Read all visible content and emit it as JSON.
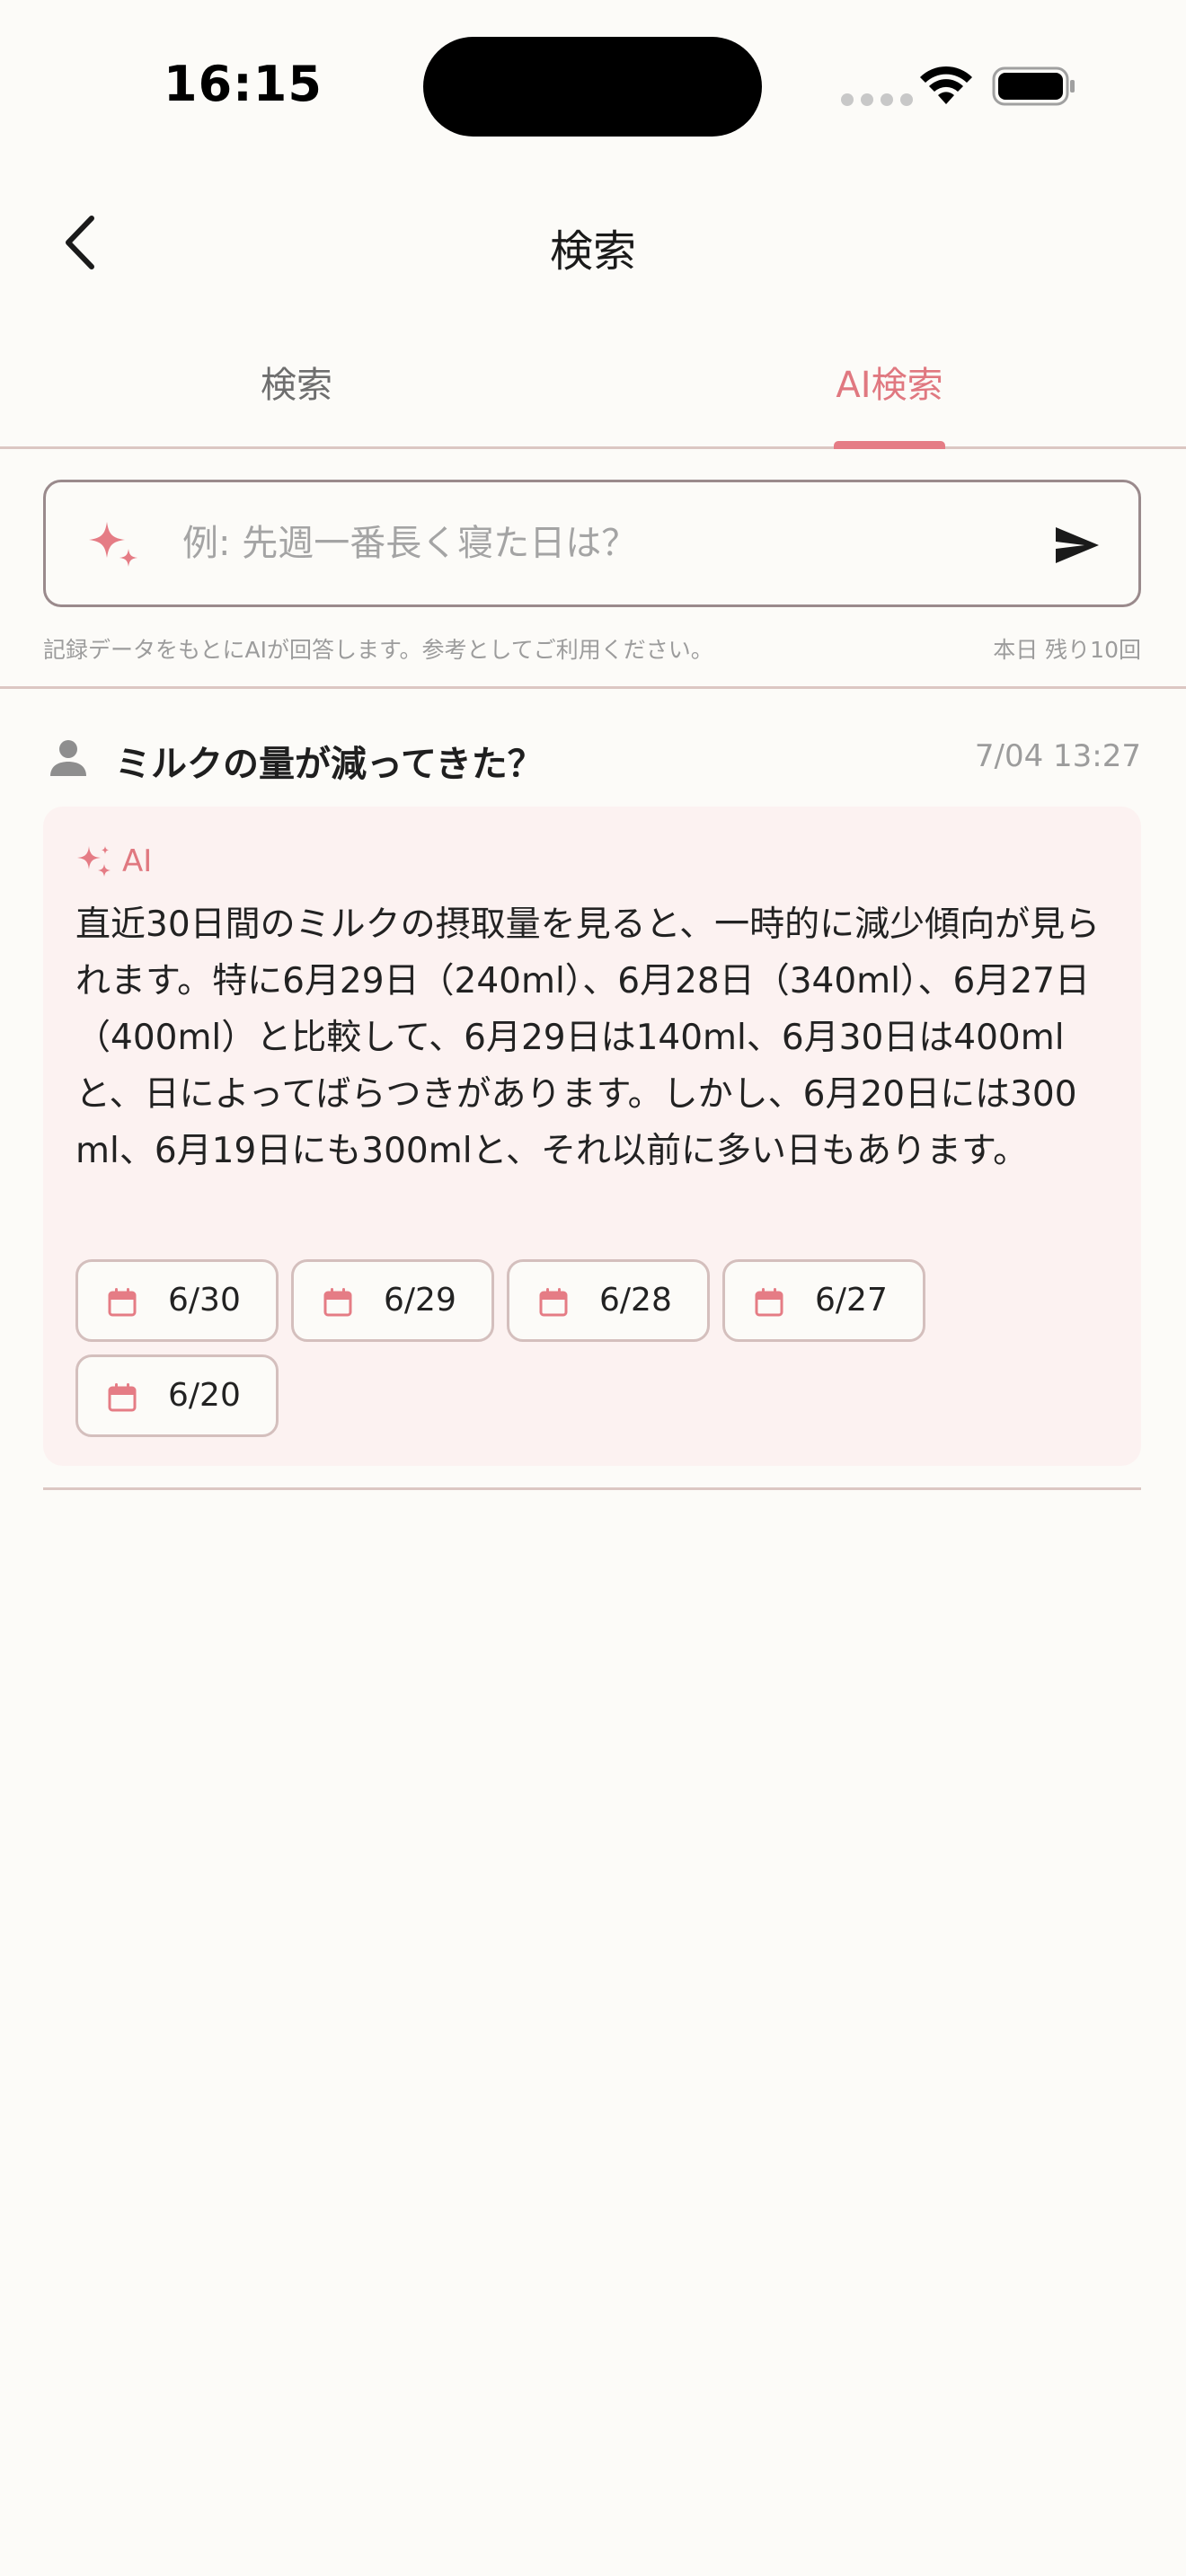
{
  "status_bar": {
    "time": "16:15"
  },
  "header": {
    "title": "検索",
    "back_icon": "chevron-left-icon"
  },
  "tabs": [
    {
      "label": "検索",
      "active": false
    },
    {
      "label": "AI検索",
      "active": true
    }
  ],
  "search": {
    "placeholder": "例: 先週一番長く寝た日は？",
    "value": "",
    "notice": "記録データをもとにAIが回答します。参考としてご利用ください。",
    "remaining": "本日 残り10回"
  },
  "conversation": {
    "question": "ミルクの量が減ってきた？",
    "timestamp": "7/04 13:27",
    "answer_label": "AI",
    "answer": "直近30日間のミルクの摂取量を見ると、一時的に減少傾向が見られます。特に6月29日（240ml）、6月28日（340ml）、6月27日（400ml）と比較して、6月29日は140ml、6月30日は400mlと、日によってばらつきがあります。しかし、6月20日には300ml、6月19日にも300mlと、それ以前に多い日もあります。",
    "dates": [
      "6/30",
      "6/29",
      "6/28",
      "6/27",
      "6/20"
    ]
  },
  "colors": {
    "background": "#fcfbf8",
    "accent": "#e57c85",
    "answer_background": "#fcf2f1",
    "divider": "#dcc7c3"
  }
}
